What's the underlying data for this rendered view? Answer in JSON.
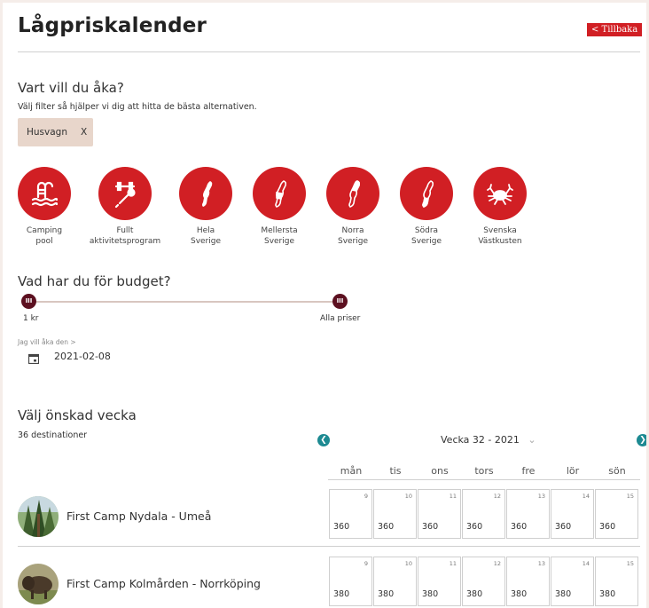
{
  "header": {
    "title": "Lågpriskalender",
    "back_label": "< Tillbaka"
  },
  "destination_filter": {
    "heading": "Vart vill du åka?",
    "helper": "Välj filter så hjälper vi dig att hitta de bästa alternativen.",
    "chip": {
      "label": "Husvagn",
      "remove": "X"
    },
    "filters": [
      {
        "icon": "pool-icon",
        "label": "Camping\npool"
      },
      {
        "icon": "activity-icon",
        "label": "Fullt\naktivitetsprogram"
      },
      {
        "icon": "sweden-map-icon",
        "label": "Hela\nSverige"
      },
      {
        "icon": "sweden-middle-map-icon",
        "label": "Mellersta\nSverige"
      },
      {
        "icon": "sweden-north-map-icon",
        "label": "Norra\nSverige"
      },
      {
        "icon": "sweden-south-map-icon",
        "label": "Södra\nSverige"
      },
      {
        "icon": "crab-icon",
        "label": "Svenska\nVästkusten"
      }
    ]
  },
  "budget": {
    "heading": "Vad har du för budget?",
    "min_label": "1 kr",
    "max_label": "Alla priser",
    "knob_symbol": "III",
    "min_fraction": 0.0,
    "max_fraction": 1.0
  },
  "date": {
    "label": "Jag vill åka den >",
    "value": "2021-02-08",
    "icon": "calendar-icon"
  },
  "week": {
    "heading": "Välj önskad vecka",
    "count": "36 destinationer",
    "selected": "Vecka 32 - 2021",
    "days": [
      "mån",
      "tis",
      "ons",
      "tors",
      "fre",
      "lör",
      "sön"
    ],
    "dates": [
      "9",
      "10",
      "11",
      "12",
      "13",
      "14",
      "15"
    ]
  },
  "destinations": [
    {
      "name": "First Camp Nydala - Umeå",
      "avatar": "forest-photo",
      "prices": [
        "360",
        "360",
        "360",
        "360",
        "360",
        "360",
        "360"
      ]
    },
    {
      "name": "First Camp Kolmården - Norrköping",
      "avatar": "bison-photo",
      "prices": [
        "380",
        "380",
        "380",
        "380",
        "380",
        "380",
        "380"
      ]
    }
  ],
  "colors": {
    "brand_red": "#d11f24",
    "knob": "#5c1020",
    "arrow": "#1d8a92",
    "chip": "#e8d6cb",
    "page_bg": "#f5ede9"
  }
}
